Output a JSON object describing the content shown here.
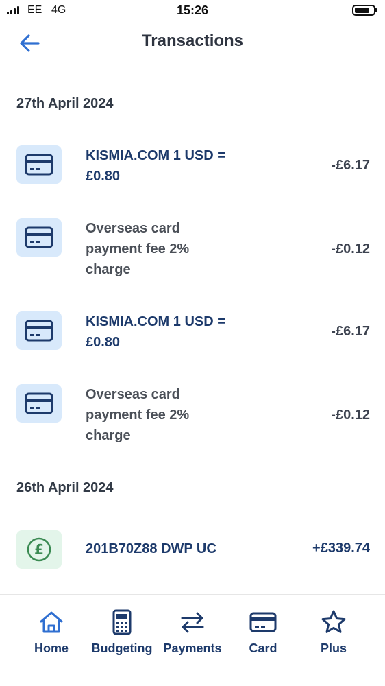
{
  "status_bar": {
    "carrier": "EE",
    "network": "4G",
    "time": "15:26"
  },
  "header": {
    "title": "Transactions",
    "back_icon": "arrow-left-icon"
  },
  "sections": [
    {
      "date": "27th April 2024",
      "transactions": [
        {
          "description": "KISMIA.COM 1 USD = £0.80",
          "amount": "-£6.17",
          "icon": "card-icon",
          "style": "navy"
        },
        {
          "description": "Overseas card payment fee 2% charge",
          "amount": "-£0.12",
          "icon": "card-icon",
          "style": "grey"
        },
        {
          "description": "KISMIA.COM 1 USD = £0.80",
          "amount": "-£6.17",
          "icon": "card-icon",
          "style": "navy"
        },
        {
          "description": "Overseas card payment fee 2% charge",
          "amount": "-£0.12",
          "icon": "card-icon",
          "style": "grey"
        }
      ]
    },
    {
      "date": "26th April 2024",
      "transactions": [
        {
          "description": "201B70Z88 DWP UC",
          "amount": "+£339.74",
          "icon": "pound-icon",
          "style": "navy"
        }
      ]
    }
  ],
  "bottom_nav": {
    "items": [
      {
        "label": "Home",
        "icon": "home-icon"
      },
      {
        "label": "Budgeting",
        "icon": "calculator-icon"
      },
      {
        "label": "Payments",
        "icon": "transfer-arrows-icon"
      },
      {
        "label": "Card",
        "icon": "card-icon"
      },
      {
        "label": "Plus",
        "icon": "star-icon"
      }
    ]
  },
  "colors": {
    "accent": "#2f6fd1",
    "navy": "#1d3a6b",
    "card_icon_bg": "#d8e9fb",
    "income_icon_bg": "#e3f5ea",
    "income_icon": "#3a8a52"
  }
}
